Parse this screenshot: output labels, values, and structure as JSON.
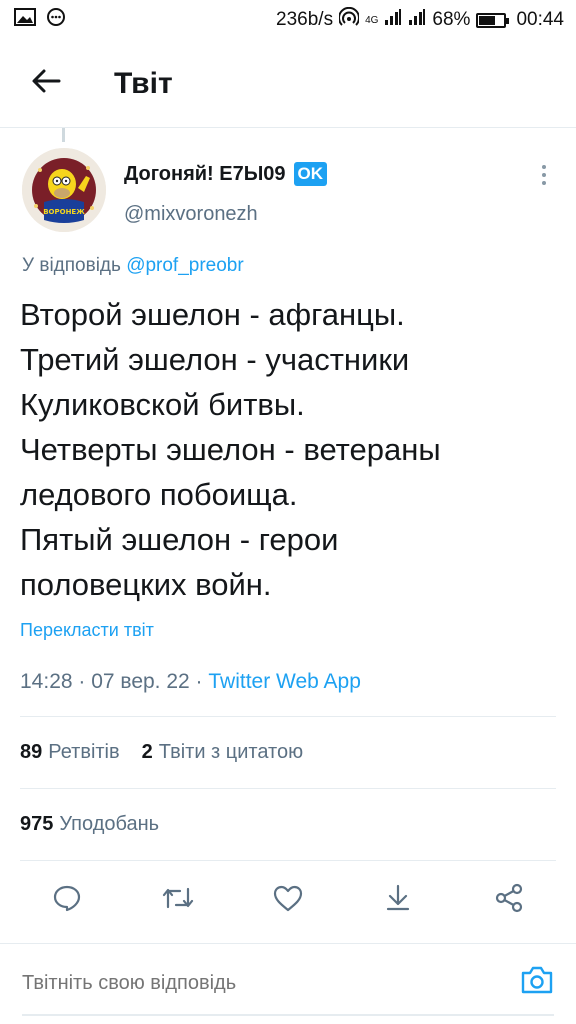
{
  "status_bar": {
    "speed": "236b/s",
    "network": "4G",
    "battery": "68%",
    "battery_level": 0.68,
    "time": "00:44",
    "left_icons": [
      "image-icon",
      "chat-bubble-icon"
    ],
    "right_icons": [
      "wifi-hotspot-icon",
      "signal-icon",
      "signal-icon",
      "battery-icon"
    ]
  },
  "header": {
    "title": "Твіт",
    "back_icon": "arrow-left-icon"
  },
  "tweet": {
    "author_name": "Догоняй! Е7Ы09",
    "badge": "OK",
    "handle": "@mixvoronezh",
    "reply_prefix": "У відповідь",
    "reply_mention": "@prof_preobr",
    "text_lines": [
      "Второй эшелон - афганцы.",
      "Третий эшелон - участники",
      "Куликовской битвы.",
      "Четверты эшелон - ветераны",
      "ледового побоища.",
      "Пятый эшелон - герои",
      "половецких войн."
    ],
    "translate_label": "Перекласти твіт",
    "timestamp": "14:28 · 07 вер. 22 · ",
    "source": "Twitter Web App"
  },
  "stats": {
    "retweets_count": "89",
    "retweets_label": "Ретвітів",
    "quotes_count": "2",
    "quotes_label": "Твіти з цитатою",
    "likes_count": "975",
    "likes_label": "Уподобань"
  },
  "actions": [
    "reply-icon",
    "retweet-icon",
    "like-icon",
    "share-download-icon",
    "share-icon"
  ],
  "reply_bar": {
    "placeholder": "Твітніть свою відповідь",
    "camera_icon": "camera-icon"
  },
  "colors": {
    "accent": "#1da1f2",
    "secondary_text": "#5b7083",
    "divider": "#e6ecf0"
  }
}
